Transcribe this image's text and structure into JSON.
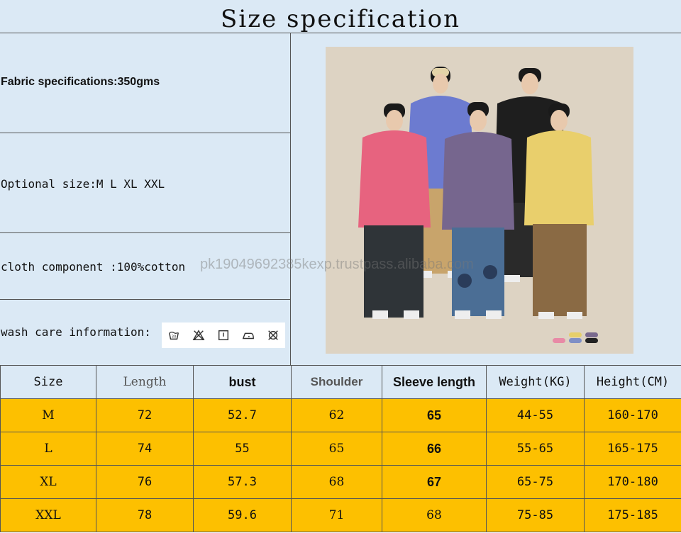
{
  "title": "Size specification",
  "info": {
    "fabric": "Fabric specifications:350gms",
    "optional_size": "Optional size:M L XL XXL",
    "component": "cloth component :100%cotton",
    "wash_care": "wash care information:"
  },
  "care_icons": [
    "wash-tub-icon",
    "no-bleach-icon",
    "tumble-dry-icon",
    "iron-icon",
    "no-dry-clean-icon"
  ],
  "watermark": "pk19049692385kexp.trustpass.alibaba.com",
  "table": {
    "headers": [
      "Size",
      "Length",
      "bust",
      "Shoulder",
      "Sleeve length",
      "Weight(KG)",
      "Height(CM)"
    ],
    "rows": [
      [
        "M",
        "72",
        "52.7",
        "62",
        "65",
        "44-55",
        "160-170"
      ],
      [
        "L",
        "74",
        "55",
        "65",
        "66",
        "55-65",
        "165-175"
      ],
      [
        "XL",
        "76",
        "57.3",
        "68",
        "67",
        "65-75",
        "170-180"
      ],
      [
        "XXL",
        "78",
        "59.6",
        "71",
        "68",
        "75-85",
        "175-185"
      ]
    ]
  },
  "colors": {
    "header_bg": "#dbe9f5",
    "row_bg": "#fdc000",
    "swatches": [
      "#e88aa6",
      "#e6cf6a",
      "#7a6a8e",
      "#7f8fc6",
      "#c9b48a",
      "#222222"
    ]
  }
}
